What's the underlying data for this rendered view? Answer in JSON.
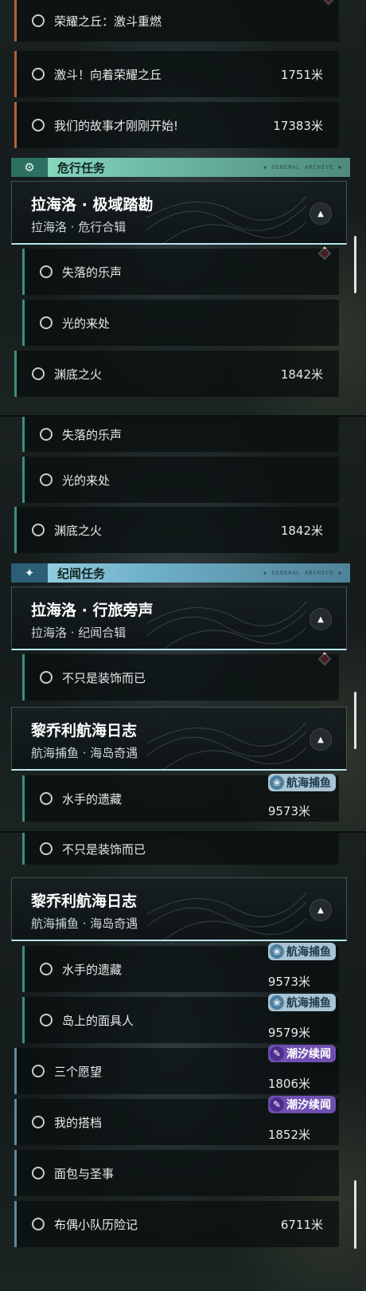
{
  "section_danger": {
    "title": "危行任务",
    "icon": "gear-icon",
    "deco": "◆ GENERAL ARCHIVE ◆"
  },
  "section_lore": {
    "title": "纪闻任务",
    "icon": "sparkle-icon",
    "deco": "◆ GENERAL ARCHIVE ◆"
  },
  "quests": {
    "glory_revive": "荣耀之丘：激斗重燃",
    "glory_fight": "激斗！向着荣耀之丘",
    "glory_fight_dist": "1751米",
    "our_story": "我们的故事才刚刚开始!",
    "our_story_dist": "17383米",
    "lost_music": "失落的乐声",
    "origin_light": "光的来处",
    "abyss_fire": "渊底之火",
    "abyss_fire_dist": "1842米",
    "decoration": "不只是装饰而已",
    "sailor_treasure": "水手的遗藏",
    "sailor_treasure_dist": "9573米",
    "island_mask": "岛上的面具人",
    "island_mask_dist": "9579米",
    "three_wishes": "三个愿望",
    "three_wishes_dist": "1806米",
    "my_partner": "我的搭档",
    "my_partner_dist": "1852米",
    "bread_saint": "面包与圣事",
    "doll_adventure": "布偶小队历险记",
    "doll_adventure_dist": "6711米"
  },
  "groups": {
    "lahailuo_polar": {
      "title": "拉海洛 · 极域踏勘",
      "subtitle": "拉海洛 · 危行合辑"
    },
    "lahailuo_travel": {
      "title": "拉海洛 · 行旅旁声",
      "subtitle": "拉海洛 · 纪闻合辑"
    },
    "ligeli_log": {
      "title": "黎乔利航海日志",
      "subtitle": "航海捕鱼 · 海岛奇遇"
    }
  },
  "tags": {
    "fishing": "航海捕鱼",
    "tide": "潮汐续闻"
  },
  "colors": {
    "danger_accent": "#8fe0c6",
    "lore_accent": "#9fd6ea",
    "alert_diamond": "#e0455a",
    "tide_tag": "#6f4fb0",
    "fishing_tag": "#a8c4d4"
  }
}
